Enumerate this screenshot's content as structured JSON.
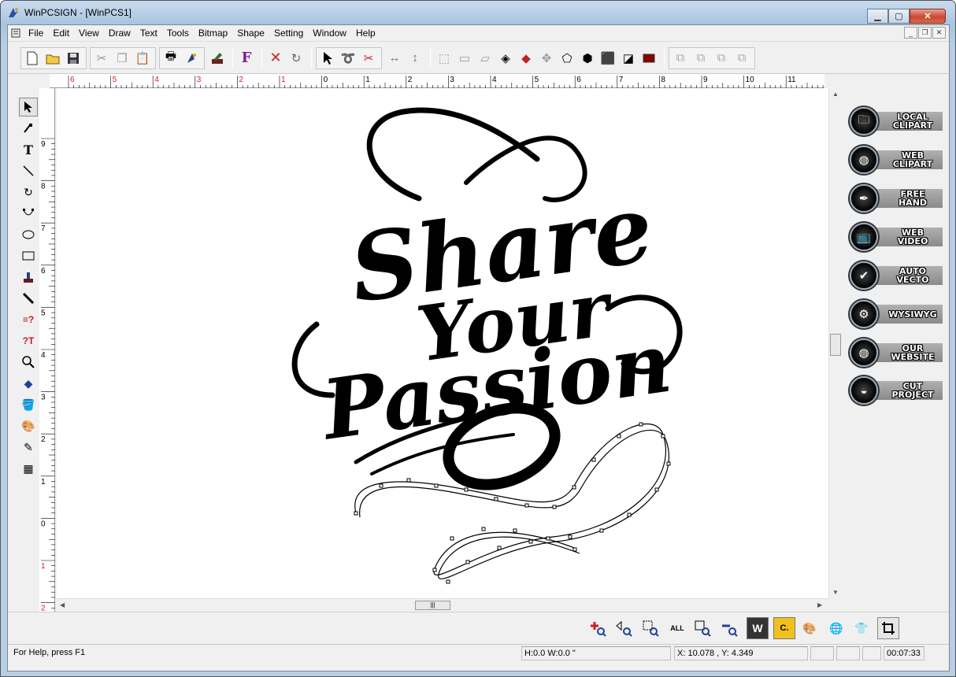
{
  "window": {
    "title": "WinPCSIGN - [WinPCS1]"
  },
  "menu": [
    "File",
    "Edit",
    "View",
    "Draw",
    "Text",
    "Tools",
    "Bitmap",
    "Shape",
    "Setting",
    "Window",
    "Help"
  ],
  "ruler": {
    "h_labels": [
      "6",
      "5",
      "4",
      "3",
      "2",
      "1",
      "0",
      "1",
      "2",
      "3",
      "4",
      "5",
      "6",
      "7",
      "8",
      "9",
      "10",
      "11"
    ],
    "v_labels": [
      "9",
      "8",
      "7",
      "6",
      "5",
      "4",
      "3",
      "2",
      "1",
      "0",
      "1",
      "2"
    ]
  },
  "artwork": {
    "line1": "Share",
    "line2": "Your",
    "line3": "Passion"
  },
  "right_panel": [
    {
      "label1": "LOCAL",
      "label2": "CLIPART",
      "icon": "folder-icon"
    },
    {
      "label1": "WEB",
      "label2": "CLIPART",
      "icon": "globe-icon"
    },
    {
      "label1": "FREE",
      "label2": "HAND",
      "icon": "pen-nib-icon"
    },
    {
      "label1": "WEB",
      "label2": "VIDEO",
      "icon": "tv-icon"
    },
    {
      "label1": "AUTO",
      "label2": "VECTO",
      "icon": "checkmark-icon"
    },
    {
      "label1": "WYSIWYG",
      "label2": "",
      "icon": "gear-icon"
    },
    {
      "label1": "OUR",
      "label2": "WEBSITE",
      "icon": "globe-icon"
    },
    {
      "label1": "CUT",
      "label2": "PROJECT",
      "icon": "mask-icon"
    }
  ],
  "status": {
    "help": "For Help, press F1",
    "size": "H:0.0   W:0.0 \"",
    "coords": "X: 10.078 , Y: 4.349",
    "time": "00:07:33"
  },
  "colors": {
    "title_bg": "#b9d1ea",
    "accent_red": "#d21f1f",
    "panel_bar": "#9a9a9a"
  }
}
